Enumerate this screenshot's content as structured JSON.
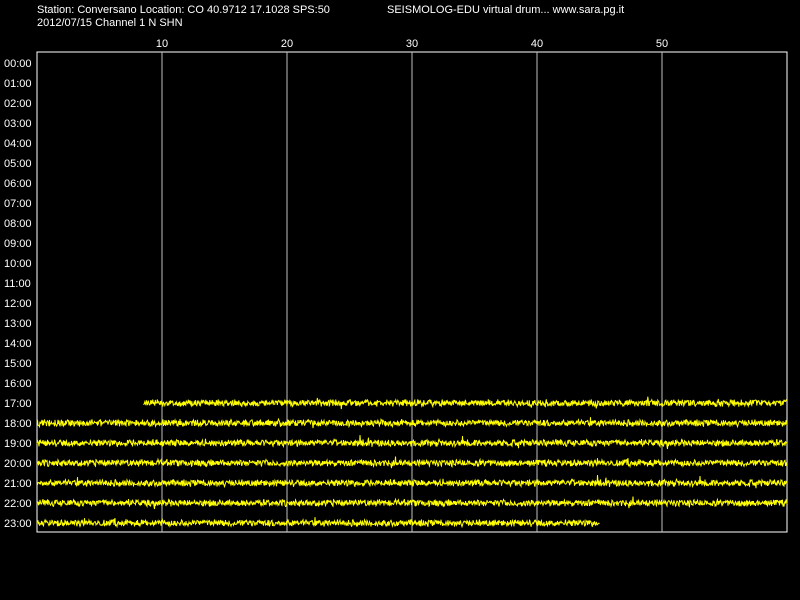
{
  "header": {
    "station_line": "Station: Conversano Location: CO 40.9712 17.1028 SPS:50",
    "date_line": "2012/07/15  Channel 1 N SHN",
    "brand_line": "SEISMOLOG-EDU virtual drum... www.sara.pg.it"
  },
  "drum": {
    "minute_ticks": [
      "10",
      "20",
      "30",
      "40",
      "50"
    ],
    "minutes_per_line": 60,
    "hours": [
      "00:00",
      "01:00",
      "02:00",
      "03:00",
      "04:00",
      "05:00",
      "06:00",
      "07:00",
      "08:00",
      "09:00",
      "10:00",
      "11:00",
      "12:00",
      "13:00",
      "14:00",
      "15:00",
      "16:00",
      "17:00",
      "18:00",
      "19:00",
      "20:00",
      "21:00",
      "22:00",
      "23:00"
    ],
    "trace_color": "#ffff00",
    "grid_color": "#ffffff",
    "background": "#000000",
    "traces": [
      {
        "hour": "17:00",
        "start_minute": 8.5,
        "end_minute": 60
      },
      {
        "hour": "18:00",
        "start_minute": 0,
        "end_minute": 60
      },
      {
        "hour": "19:00",
        "start_minute": 0,
        "end_minute": 60
      },
      {
        "hour": "20:00",
        "start_minute": 0,
        "end_minute": 60
      },
      {
        "hour": "21:00",
        "start_minute": 0,
        "end_minute": 60
      },
      {
        "hour": "22:00",
        "start_minute": 0,
        "end_minute": 60
      },
      {
        "hour": "23:00",
        "start_minute": 0,
        "end_minute": 45
      }
    ]
  }
}
